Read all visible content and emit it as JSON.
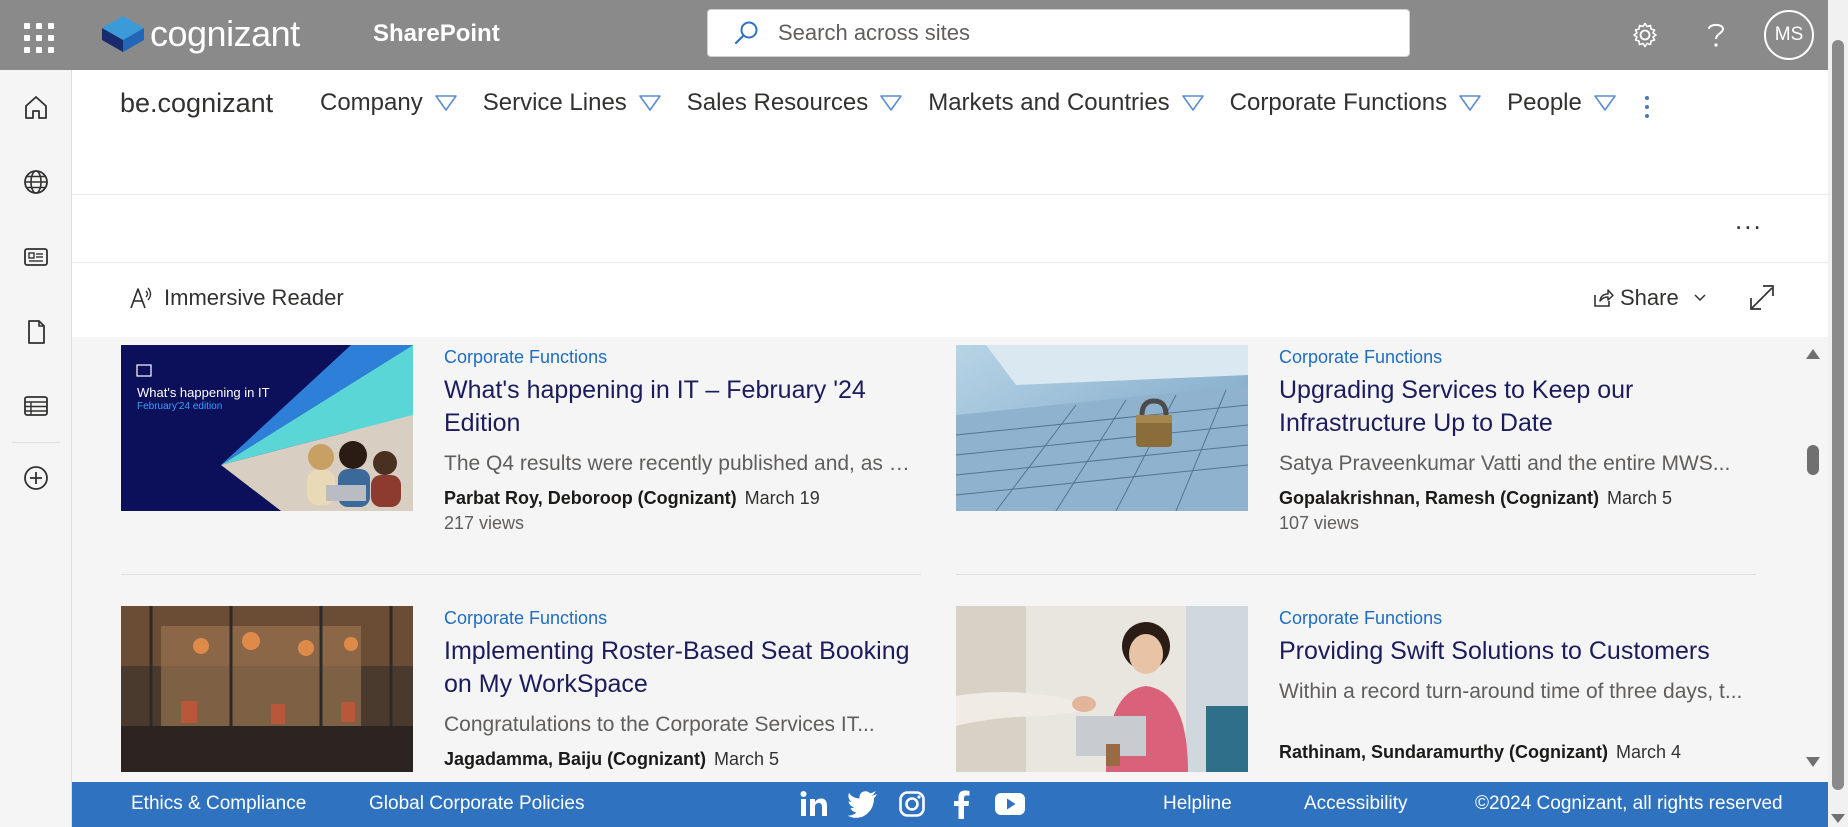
{
  "suite": {
    "logo_text": "cognizant",
    "app_name": "SharePoint",
    "search_placeholder": "Search across sites",
    "user_initials": "MS"
  },
  "site": {
    "title": "be.cognizant",
    "nav": [
      {
        "label": "Company"
      },
      {
        "label": "Service Lines"
      },
      {
        "label": "Sales Resources"
      },
      {
        "label": "Markets and Countries"
      },
      {
        "label": "Corporate Functions"
      },
      {
        "label": "People"
      }
    ]
  },
  "commandbar": {
    "more": "...",
    "immersive_reader": "Immersive Reader",
    "share": "Share"
  },
  "news": [
    {
      "category": "Corporate Functions",
      "title": "What's happening in IT – February '24 Edition",
      "description": "The Q4 results were recently published and, as Ra...",
      "author": "Parbat Roy, Deboroop (Cognizant)",
      "date": "March 19",
      "views": "217 views",
      "thumb_heading": "What's happening in IT",
      "thumb_sub": "February'24 edition"
    },
    {
      "category": "Corporate Functions",
      "title": "Upgrading Services to Keep our Infrastructure Up to Date",
      "description": "Satya Praveenkumar Vatti and the entire MWS...",
      "author": "Gopalakrishnan, Ramesh (Cognizant)",
      "date": "March 5",
      "views": "107 views"
    },
    {
      "category": "Corporate Functions",
      "title": "Implementing Roster-Based Seat Booking on My WorkSpace",
      "description": "Congratulations to the Corporate Services IT...",
      "author": "Jagadamma, Baiju (Cognizant)",
      "date": "March 5"
    },
    {
      "category": "Corporate Functions",
      "title": "Providing Swift Solutions to Customers",
      "description": "Within a record turn-around time of three days, t...",
      "author": "Rathinam, Sundaramurthy (Cognizant)",
      "date": "March 4"
    }
  ],
  "footer": {
    "ethics": "Ethics & Compliance",
    "policies": "Global Corporate Policies",
    "helpline": "Helpline",
    "accessibility": "Accessibility",
    "copyright": "©2024 Cognizant, all rights reserved"
  }
}
